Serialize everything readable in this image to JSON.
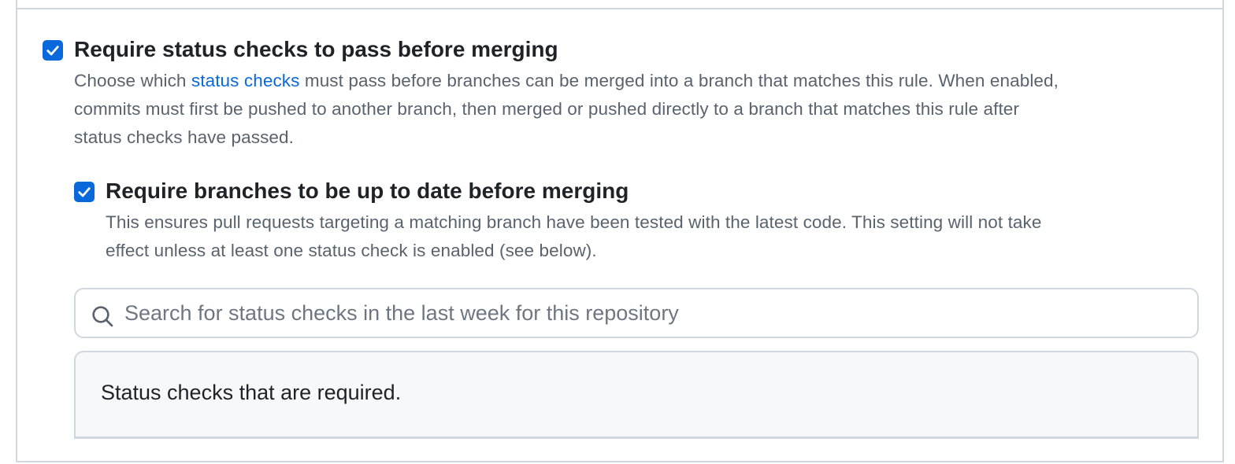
{
  "status_checks_rule": {
    "checked": true,
    "title": "Require status checks to pass before merging",
    "desc_prefix": "Choose which ",
    "desc_link": "status checks",
    "desc_line1_suffix": " must pass before branches can be merged into a branch that matches this rule. When enabled,",
    "desc_line2": "commits must first be pushed to another branch, then merged or pushed directly to a branch that matches this rule after",
    "desc_line3": "status checks have passed."
  },
  "up_to_date_rule": {
    "checked": true,
    "title": "Require branches to be up to date before merging",
    "desc_line1": "This ensures pull requests targeting a matching branch have been tested with the latest code. This setting will not take",
    "desc_line2": "effect unless at least one status check is enabled (see below)."
  },
  "search": {
    "icon": "search-icon",
    "value": "",
    "placeholder": "Search for status checks in the last week for this repository"
  },
  "required_checks": {
    "label": "Status checks that are required."
  },
  "colors": {
    "accent": "#0969da",
    "border": "#d0d7de",
    "muted_text": "#59636e"
  }
}
